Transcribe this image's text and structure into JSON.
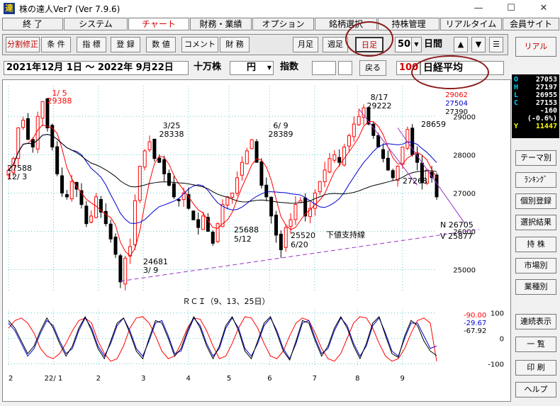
{
  "window": {
    "title": "株の達人Ver7 (Ver 7.9.6)",
    "icon_char": "達",
    "minimize": "—",
    "maximize": "☐",
    "close": "✕"
  },
  "menu": [
    "終 了",
    "システム",
    "チャート",
    "財務・業績",
    "オプション",
    "銘柄選択",
    "持株管理",
    "リアルタイム",
    "会員サイト"
  ],
  "toolbar": {
    "buttons": [
      "分割修正",
      "条 件",
      "指 標",
      "登 録",
      "数 値",
      "コメント",
      "財 務"
    ],
    "period": [
      "月足",
      "週足",
      "日足"
    ],
    "count": "50",
    "period_label": "日間",
    "menu_icon": "☰",
    "up": "▲",
    "down": "▼"
  },
  "daterow": {
    "range": "2021年12月 1日 ～ 2022年 9月22日",
    "unit": "十万株",
    "yen": "円",
    "index_label": "指数",
    "back": "戻る",
    "code": "100",
    "name": "日経平均"
  },
  "quote": {
    "labels": [
      "O",
      "H",
      "L",
      "C"
    ],
    "values": [
      "27053",
      "27197",
      "26955",
      "27153"
    ],
    "change": "-160",
    "pct": "(-0.6%)",
    "y_label": "Y",
    "y_value": "11447"
  },
  "sidebar": {
    "real": "リアル",
    "buttons": [
      "テーマ別",
      "ﾗﾝｷﾝｸﾞ",
      "個別登録",
      "選択結果",
      "持 株",
      "市場別",
      "業種別",
      "連続表示",
      "一 覧",
      "印 刷",
      "ヘルプ"
    ]
  },
  "colors": {
    "up": "#ff0000",
    "down": "#000000",
    "ma_short": "#ff0000",
    "ma_mid": "#0000cc",
    "ma_long": "#000000",
    "support": "#9b30c8",
    "rci_a": "#ff0000",
    "rci_b": "#0000cc",
    "rci_c": "#000000"
  },
  "chart_data": [
    {
      "type": "candlestick",
      "title": "",
      "yticks": [
        25000,
        26000,
        27000,
        28000,
        29000
      ],
      "ylim": [
        24400,
        29800
      ],
      "xticks": [
        "2",
        "22/ 1",
        "2",
        "3",
        "4",
        "5",
        "6",
        "7",
        "8",
        "9"
      ],
      "ma_values": [
        {
          "value": "29062",
          "color": "#ff0000"
        },
        {
          "value": "27504",
          "color": "#0000cc"
        },
        {
          "value": "27390",
          "color": "#000000"
        }
      ],
      "annotations": [
        {
          "text": "1/ 5",
          "value": 29388,
          "color": "#ff0000"
        },
        {
          "text": "29388",
          "color": "#ff0000"
        },
        {
          "text": "27588",
          "color": "#000000"
        },
        {
          "text": "12/ 3",
          "color": "#000000"
        },
        {
          "text": "3/25",
          "color": "#000000"
        },
        {
          "text": "28338",
          "color": "#000000"
        },
        {
          "text": "6/ 9",
          "color": "#000000"
        },
        {
          "text": "28389",
          "color": "#000000"
        },
        {
          "text": "8/17",
          "color": "#000000"
        },
        {
          "text": "29222",
          "color": "#000000"
        },
        {
          "text": "28659",
          "color": "#000000"
        },
        {
          "text": "27268",
          "color": "#000000"
        },
        {
          "text": "24681",
          "color": "#000000"
        },
        {
          "text": "3/ 9",
          "color": "#000000"
        },
        {
          "text": "25688",
          "color": "#000000"
        },
        {
          "text": "5/12",
          "color": "#000000"
        },
        {
          "text": "25520",
          "color": "#000000"
        },
        {
          "text": "6/20",
          "color": "#000000"
        },
        {
          "text": "下値支持線",
          "color": "#000000"
        },
        {
          "text": "N  26705",
          "color": "#000000"
        },
        {
          "text": "V  25877",
          "color": "#000000"
        }
      ],
      "close_path": [
        27588,
        27900,
        28700,
        28900,
        28400,
        28200,
        29000,
        29388,
        28700,
        28200,
        27500,
        27000,
        26900,
        27300,
        27100,
        26700,
        26200,
        26400,
        26900,
        26500,
        26200,
        25800,
        25400,
        24681,
        25300,
        25600,
        26800,
        27700,
        28100,
        28338,
        27900,
        27800,
        27500,
        27200,
        26900,
        26800,
        27000,
        26600,
        26300,
        26100,
        26400,
        26000,
        25688,
        26200,
        26700,
        26900,
        27000,
        27400,
        27800,
        28100,
        28389,
        27800,
        27200,
        26900,
        26400,
        25900,
        25520,
        26100,
        26300,
        26700,
        26800,
        26400,
        26600,
        27000,
        27300,
        27600,
        27900,
        28000,
        27800,
        28200,
        28500,
        28800,
        29000,
        29222,
        28800,
        28500,
        28200,
        27900,
        27600,
        27400,
        27700,
        28200,
        28659,
        28000,
        27800,
        27268,
        27600,
        27400,
        26900
      ]
    },
    {
      "type": "line",
      "title": "ＲＣＩ（9、13、25日）",
      "yticks": [
        100,
        0,
        -100
      ],
      "ylim": [
        -110,
        110
      ],
      "series": [
        {
          "name": "",
          "color": "#ff0000",
          "last": "-90.00",
          "values": [
            40,
            70,
            80,
            60,
            20,
            -40,
            -70,
            -80,
            -60,
            -20,
            30,
            70,
            80,
            60,
            -10,
            -60,
            -90,
            -80,
            -30,
            40,
            80,
            85,
            60,
            10,
            -50,
            -80,
            -70,
            -20,
            40,
            80,
            75,
            30,
            -30,
            -80,
            -70,
            -20,
            40,
            85,
            80,
            40,
            -20,
            -70,
            -80,
            -50,
            10,
            60,
            80,
            70,
            20,
            -40,
            -80,
            -90,
            -60,
            0,
            60,
            85,
            80,
            40,
            -20,
            -70,
            -90,
            -80,
            -40,
            20,
            70,
            80,
            60,
            -90
          ]
        },
        {
          "name": "",
          "color": "#0000cc",
          "last": "-29.67",
          "values": [
            60,
            30,
            -20,
            -70,
            -40,
            20,
            70,
            50,
            -10,
            -60,
            -40,
            30,
            80,
            40,
            -30,
            -70,
            -20,
            50,
            80,
            30,
            -40,
            -70,
            -10,
            60,
            70,
            10,
            -60,
            -50,
            20,
            80,
            50,
            -20,
            -70,
            -40,
            40,
            80,
            40,
            -40,
            -70,
            -20,
            50,
            80,
            30,
            -40,
            -80,
            -20,
            60,
            70,
            0,
            -60,
            -40,
            30,
            80,
            50,
            -20,
            -70,
            -30,
            50,
            80,
            20,
            -50,
            -70,
            0,
            60,
            60,
            10,
            -40,
            -29.67
          ]
        },
        {
          "name": "",
          "color": "#000000",
          "last": "-67.92",
          "values": [
            70,
            40,
            -10,
            -60,
            -30,
            30,
            80,
            40,
            -20,
            -70,
            -30,
            40,
            85,
            30,
            -40,
            -80,
            -10,
            60,
            80,
            20,
            -50,
            -80,
            0,
            70,
            60,
            0,
            -70,
            -40,
            30,
            85,
            40,
            -30,
            -80,
            -30,
            50,
            85,
            30,
            -50,
            -80,
            -10,
            60,
            85,
            20,
            -50,
            -85,
            -10,
            70,
            60,
            -10,
            -70,
            -30,
            40,
            85,
            40,
            -30,
            -80,
            -20,
            60,
            85,
            10,
            -60,
            -75,
            10,
            70,
            50,
            -10,
            -50,
            -67.92
          ]
        }
      ],
      "xticks": [
        "2",
        "22/ 1",
        "2",
        "3",
        "4",
        "5",
        "6",
        "7",
        "8",
        "9"
      ]
    }
  ]
}
